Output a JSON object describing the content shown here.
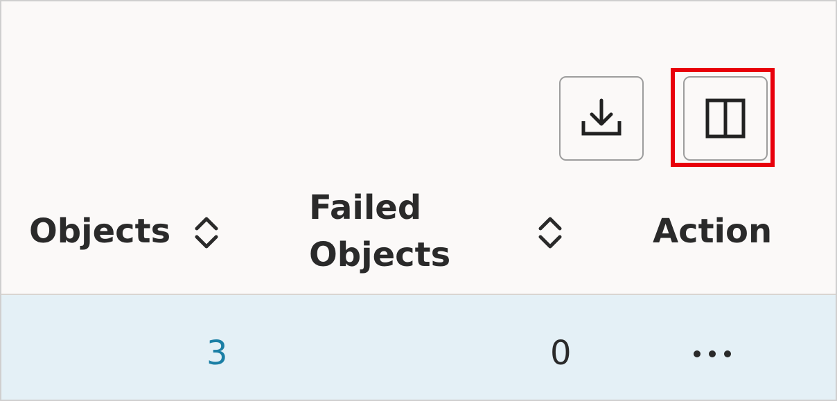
{
  "toolbar": {
    "export_icon": "download-icon",
    "columns_icon": "column-panel-icon",
    "highlight_color": "#e8000b"
  },
  "table": {
    "headers": {
      "objects": "Objects",
      "failed_line1": "Failed",
      "failed_line2": "Objects",
      "action": "Action"
    },
    "rows": [
      {
        "objects": "3",
        "failed_objects": "0",
        "action_icon": "more-horizontal-icon"
      }
    ]
  },
  "colors": {
    "background": "#fbf9f8",
    "row_selected": "#e4f0f6",
    "link": "#1b7fa5",
    "text": "#2a2a2a"
  }
}
